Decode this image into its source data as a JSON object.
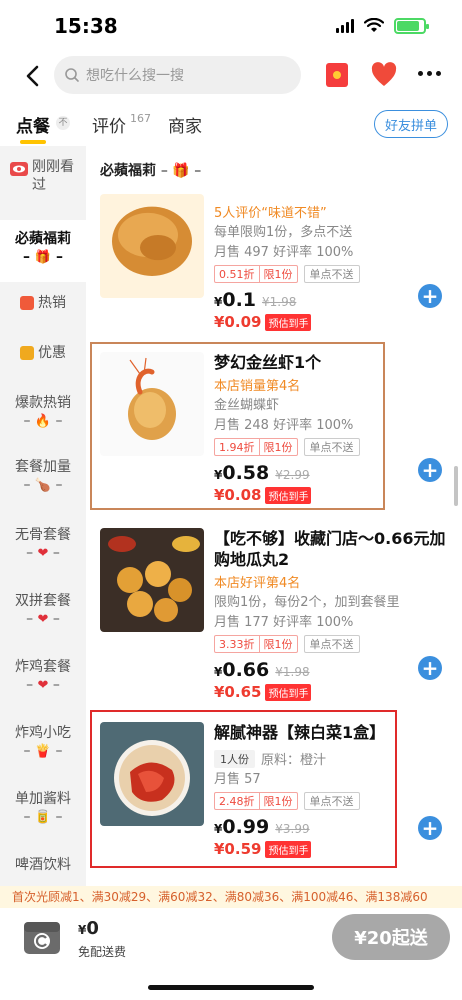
{
  "status": {
    "time": "15:38"
  },
  "nav": {
    "search_placeholder": "想吃什么搜一搜"
  },
  "tabs": {
    "order": "点餐",
    "order_badge": "不",
    "reviews": "评价",
    "reviews_count": "167",
    "merchant": "商家",
    "group_order": "好友拼单"
  },
  "sidebar": {
    "items": [
      {
        "label": "刚刚看过",
        "icon": "eye-icon"
      },
      {
        "label": "必蘋福莉",
        "icon": "gift-icon"
      },
      {
        "label": "热销",
        "icon": "flame-icon"
      },
      {
        "label": "优惠",
        "icon": "coupon-icon"
      },
      {
        "label": "爆款热销",
        "icon": "fire-emoji"
      },
      {
        "label": "套餐加量",
        "icon": "chicken-leg-emoji"
      },
      {
        "label": "无骨套餐",
        "icon": "heart-emoji"
      },
      {
        "label": "双拼套餐",
        "icon": "heart-emoji"
      },
      {
        "label": "炸鸡套餐",
        "icon": "heart-emoji"
      },
      {
        "label": "炸鸡小吃",
        "icon": "fries-emoji"
      },
      {
        "label": "单加酱料",
        "icon": "sauce-emoji"
      },
      {
        "label": "啤酒饮料",
        "icon": ""
      }
    ]
  },
  "section": {
    "title": "必蘋福莉"
  },
  "products": [
    {
      "name": "",
      "highlight": "5人评价“味道不错”",
      "lines": [
        "每单限购1份，多点不送",
        "月售 497  好评率 100%"
      ],
      "discount": "0.51折",
      "limit": "限1份",
      "no_delivery": "单点不送",
      "price": "0.1",
      "orig": "¥1.98",
      "est": "¥0.09",
      "est_label": "预估到手"
    },
    {
      "name": "梦幻金丝虾1个",
      "highlight": "本店销量第4名",
      "lines": [
        "金丝蝴蝶虾",
        "月售 248  好评率 100%"
      ],
      "discount": "1.94折",
      "limit": "限1份",
      "no_delivery": "单点不送",
      "price": "0.58",
      "orig": "¥2.99",
      "est": "¥0.08",
      "est_label": "预估到手"
    },
    {
      "name": "【吃不够】收藏门店～0.66元加购地瓜丸2",
      "highlight": "本店好评第4名",
      "lines": [
        "限购1份，每份2个，加到套餐里",
        "月售 177  好评率 100%"
      ],
      "discount": "3.33折",
      "limit": "限1份",
      "no_delivery": "单点不送",
      "price": "0.66",
      "orig": "¥1.98",
      "est": "¥0.65",
      "est_label": "预估到手"
    },
    {
      "name": "解腻神器【辣白菜1盒】",
      "portion": "1人份",
      "material": "原料：橙汁",
      "lines": [
        "月售 57"
      ],
      "discount": "2.48折",
      "limit": "限1份",
      "no_delivery": "单点不送",
      "price": "0.99",
      "orig": "¥3.99",
      "est": "¥0.59",
      "est_label": "预估到手"
    }
  ],
  "promo": "首次光顾减1、满30减29、满60减32、满80减36、满100减46、满138减60",
  "cart": {
    "currency": "¥",
    "amount": "0",
    "note": "免配送费",
    "checkout": "¥20起送"
  },
  "colors": {
    "accent": "#3b8fde",
    "price_red": "#ee3b2f",
    "tab_underline": "#ffc300"
  }
}
